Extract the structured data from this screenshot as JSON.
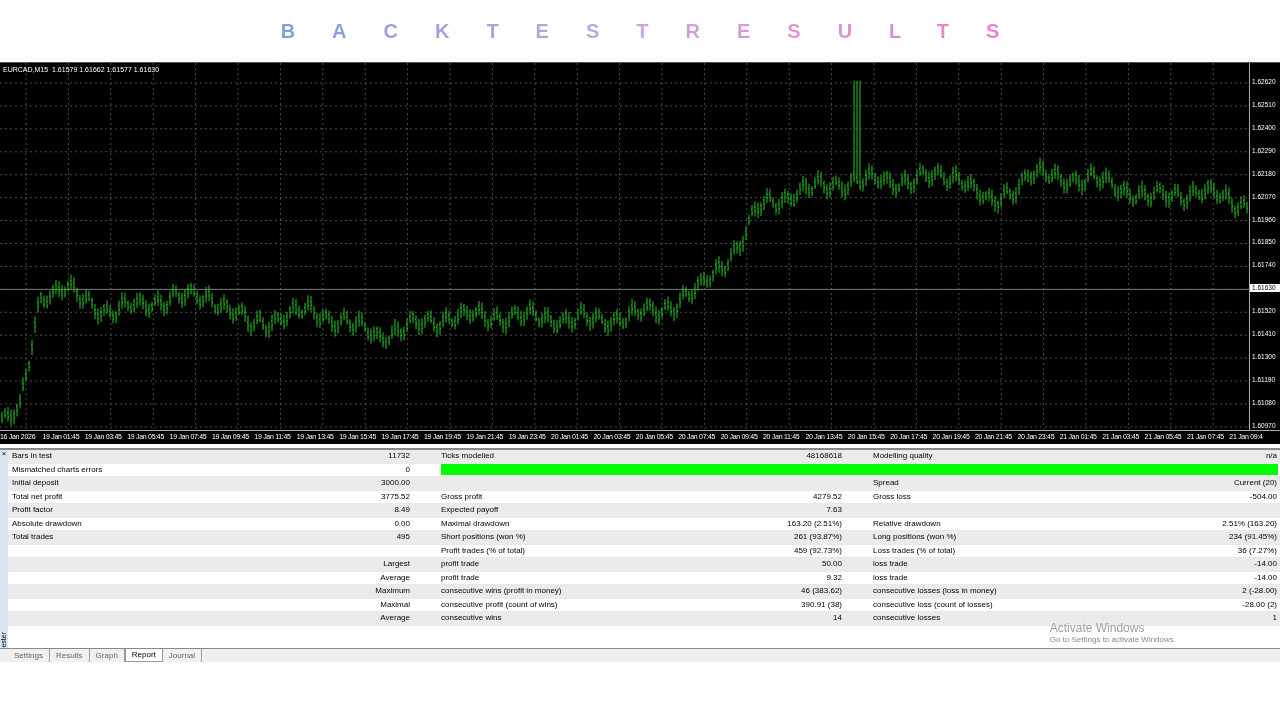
{
  "title": "BACKTESTRESULTS",
  "chart": {
    "header": "EURCAD,M15  1.61579 1.61662 1.61577 1.61630",
    "price_labels": [
      {
        "text": "1.62620",
        "selected": false
      },
      {
        "text": "1.62510",
        "selected": false
      },
      {
        "text": "1.62400",
        "selected": false
      },
      {
        "text": "1.62290",
        "selected": false
      },
      {
        "text": "1.62180",
        "selected": false
      },
      {
        "text": "1.62070",
        "selected": false
      },
      {
        "text": "1.61960",
        "selected": false
      },
      {
        "text": "1.61850",
        "selected": false
      },
      {
        "text": "1.61740",
        "selected": false
      },
      {
        "text": "1.61630",
        "selected": true
      },
      {
        "text": "1.61520",
        "selected": false
      },
      {
        "text": "1.61410",
        "selected": false
      },
      {
        "text": "1.61300",
        "selected": false
      },
      {
        "text": "1.61190",
        "selected": false
      },
      {
        "text": "1.61080",
        "selected": false
      },
      {
        "text": "1.60970",
        "selected": false
      }
    ],
    "time_labels": [
      "16 Jan 2026",
      "19 Jan 01:45",
      "19 Jan 03:45",
      "19 Jan 05:45",
      "19 Jan 07:45",
      "19 Jan 09:45",
      "19 Jan 11:45",
      "19 Jan 13:45",
      "19 Jan 15:45",
      "19 Jan 17:45",
      "19 Jan 19:45",
      "19 Jan 21:45",
      "19 Jan 23:45",
      "20 Jan 01:45",
      "20 Jan 03:45",
      "20 Jan 05:45",
      "20 Jan 07:45",
      "20 Jan 09:45",
      "20 Jan 11:45",
      "20 Jan 13:45",
      "20 Jan 15:45",
      "20 Jan 17:45",
      "20 Jan 19:45",
      "20 Jan 21:45",
      "20 Jan 23:45",
      "21 Jan 01:45",
      "21 Jan 03:45",
      "21 Jan 05:45",
      "21 Jan 07:45",
      "21 Jan 09:4"
    ]
  },
  "report": {
    "close": "×",
    "rows": [
      {
        "kind": "text",
        "c1": "Bars in test",
        "c2": "11732",
        "c3": "Ticks modelled",
        "c4": "48168618",
        "c5": "Modelling quality",
        "c6": "n/a"
      },
      {
        "kind": "bar",
        "c1": "Mismatched charts errors",
        "c2": "0",
        "level": 1
      },
      {
        "kind": "text",
        "c1": "Initial deposit",
        "c2": "3000.00",
        "c5": "Spread",
        "c6": "Current (20)"
      },
      {
        "kind": "text",
        "c1": "Total net profit",
        "c2": "3775.52",
        "c3": "Gross profit",
        "c4": "4279.52",
        "c5": "Gross loss",
        "c6": "-504.00"
      },
      {
        "kind": "text",
        "c1": "Profit factor",
        "c2": "8.49",
        "c3": "Expected payoff",
        "c4": "7.63"
      },
      {
        "kind": "text",
        "c1": "Absolute drawdown",
        "c2": "0.00",
        "c3": "Maximal drawdown",
        "c4": "163.20 (2.51%)",
        "c5": "Relative drawdown",
        "c6": "2.51% (163.20)"
      },
      {
        "kind": "text",
        "c1": "Total trades",
        "c2": "495",
        "c3": "Short positions (won %)",
        "c4": "261 (93.87%)",
        "c5": "Long positions (won %)",
        "c6": "234 (91.45%)"
      },
      {
        "kind": "text",
        "c3": "Profit trades (% of total)",
        "c4": "459 (92.73%)",
        "c5": "Loss trades (% of total)",
        "c6": "36 (7.27%)"
      },
      {
        "kind": "text",
        "c2": "Largest",
        "c3": "profit trade",
        "c4": "50.00",
        "c5": "loss trade",
        "c6": "-14.00"
      },
      {
        "kind": "text",
        "c2": "Average",
        "c3": "profit trade",
        "c4": "9.32",
        "c5": "loss trade",
        "c6": "-14.00"
      },
      {
        "kind": "text",
        "c2": "Maximum",
        "c3": "consecutive wins (profit in money)",
        "c4": "46 (383.62)",
        "c5": "consecutive losses (loss in money)",
        "c6": "2 (-28.00)"
      },
      {
        "kind": "text",
        "c2": "Maximal",
        "c3": "consecutive profit (count of wins)",
        "c4": "390.91 (38)",
        "c5": "consecutive loss (count of losses)",
        "c6": "-28.00 (2)"
      },
      {
        "kind": "text",
        "c2": "Average",
        "c3": "consecutive wins",
        "c4": "14",
        "c5": "consecutive losses",
        "c6": "1"
      }
    ],
    "side_label": "ester",
    "notice": {
      "title": "Activate Windows",
      "subtitle": "Go to Settings to activate Windows."
    }
  },
  "tabs": [
    {
      "label": "Settings",
      "selected": false
    },
    {
      "label": "Results",
      "selected": false
    },
    {
      "label": "Graph",
      "selected": false
    },
    {
      "label": "Report",
      "selected": true
    },
    {
      "label": "Journal",
      "selected": false
    }
  ]
}
